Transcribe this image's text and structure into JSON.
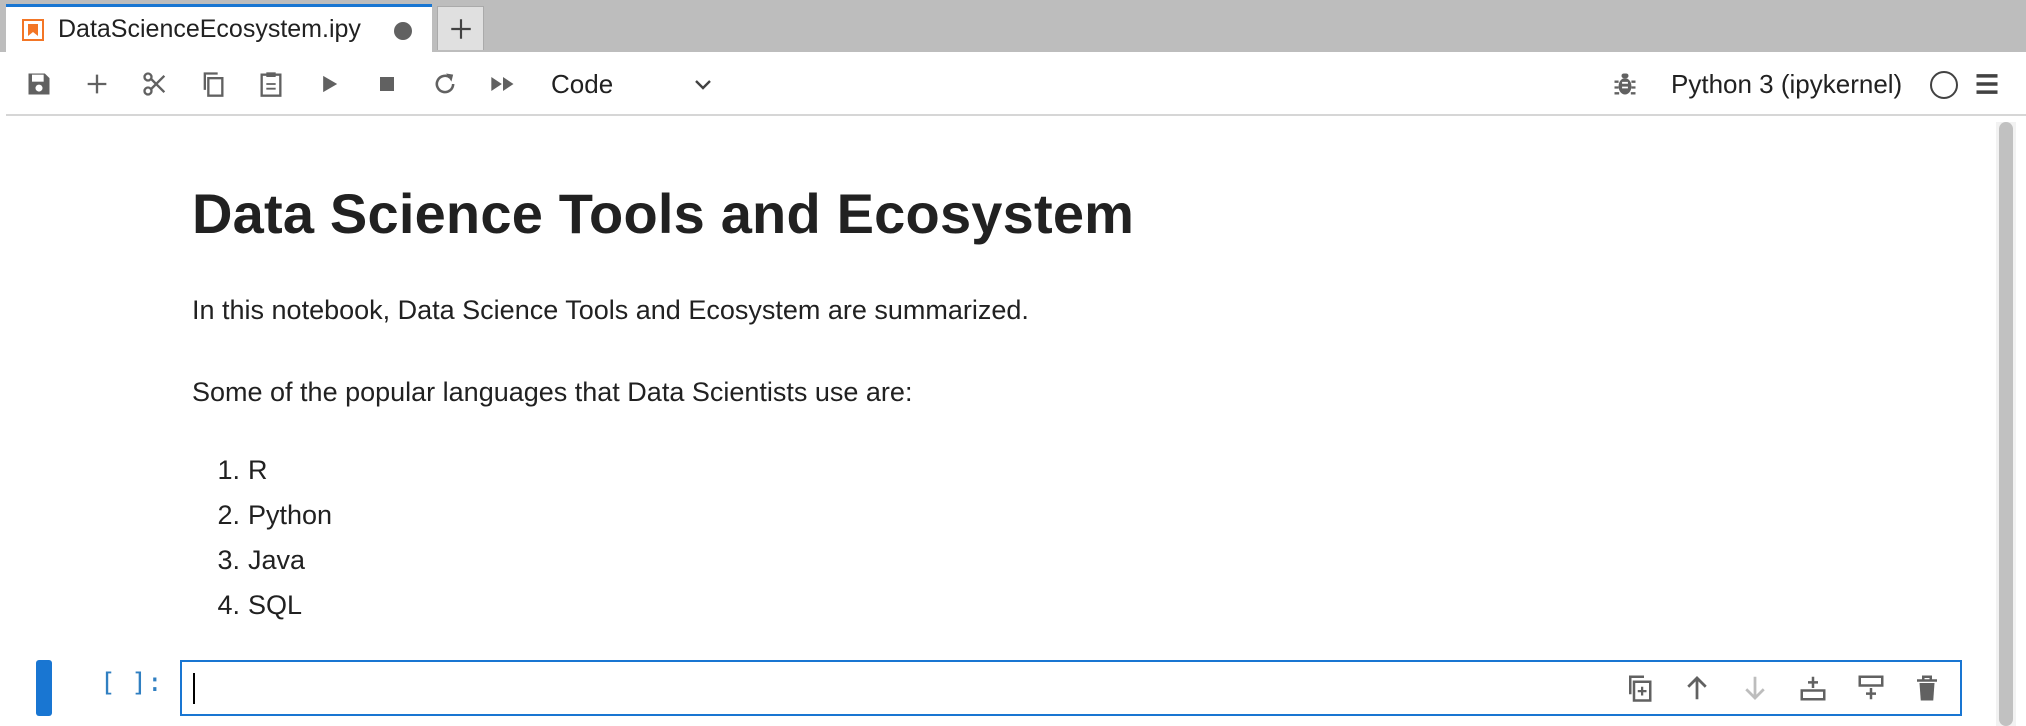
{
  "tab": {
    "title": "DataScienceEcosystem.ipy",
    "icon": "notebook-icon",
    "dirty": true,
    "add_icon": "plus-icon"
  },
  "toolbar": {
    "buttons": [
      "save-icon",
      "add-cell-icon",
      "cut-icon",
      "copy-icon",
      "paste-icon",
      "run-icon",
      "stop-icon",
      "restart-icon",
      "run-all-icon"
    ],
    "cell_type": "Code",
    "debugger_icon": "bug-icon",
    "kernel_name": "Python 3 (ipykernel)",
    "kernel_status_icon": "kernel-idle-icon",
    "menu_icon": "hamburger-menu-icon"
  },
  "notebook": {
    "heading": "Data Science Tools and Ecosystem",
    "intro": "In this notebook, Data Science Tools and Ecosystem are summarized.",
    "languages_intro": "Some of the popular languages that Data Scientists use are:",
    "languages": [
      {
        "num": "1.",
        "label": "R"
      },
      {
        "num": "2.",
        "label": "Python"
      },
      {
        "num": "3.",
        "label": "Java"
      },
      {
        "num": "4.",
        "label": "SQL"
      }
    ]
  },
  "active_cell": {
    "prompt": "[ ]:",
    "value": "",
    "tools": [
      "duplicate-cell-icon",
      "move-up-icon",
      "move-down-icon",
      "insert-below-icon",
      "insert-above-icon",
      "delete-cell-icon"
    ]
  },
  "colors": {
    "accent": "#1976d2",
    "prompt": "#307fc1",
    "tab_icon": "#f37626"
  }
}
